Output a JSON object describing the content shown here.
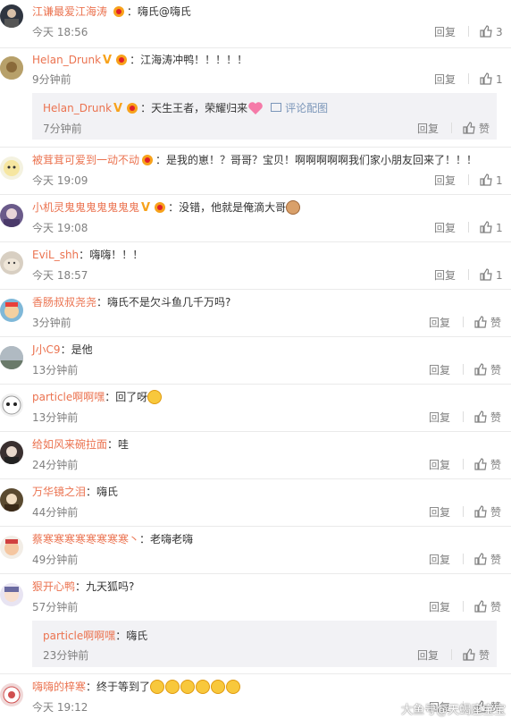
{
  "comments": [
    {
      "user": "江谦最爱江海涛",
      "content": "嗨氏@嗨氏",
      "time": "今天 18:56",
      "reply": "回复",
      "likes": "3"
    },
    {
      "user": "Helan_Drunk",
      "content": "江海涛冲鸭！！！！！",
      "time": "9分钟前",
      "reply": "回复",
      "likes": "1"
    },
    {
      "user": "Helan_Drunk",
      "content": "天生王者，荣耀归来",
      "pic_link": "评论配图",
      "time": "7分钟前",
      "reply": "回复",
      "likes": "赞"
    },
    {
      "user": "被茸茸可爱到一动不动",
      "content": "是我的崽！？哥哥？宝贝！啊啊啊啊啊我们家小朋友回来了！！！",
      "time": "今天 19:09",
      "reply": "回复",
      "likes": "1"
    },
    {
      "user": "小机灵鬼鬼鬼鬼鬼鬼鬼",
      "content": "没错，他就是俺滴大哥",
      "time": "今天 19:08",
      "reply": "回复",
      "likes": "1"
    },
    {
      "user": "EviL_shh",
      "content": "嗨嗨！！！",
      "time": "今天 18:57",
      "reply": "回复",
      "likes": "1"
    },
    {
      "user": "香肠叔叔尧尧",
      "content": "嗨氏不是欠斗鱼几千万吗?",
      "time": "3分钟前",
      "reply": "回复",
      "likes": "赞"
    },
    {
      "user": "J小C9",
      "content": "是他",
      "time": "13分钟前",
      "reply": "回复",
      "likes": "赞"
    },
    {
      "user": "particle啊啊嘿",
      "content": "回了呀",
      "time": "13分钟前",
      "reply": "回复",
      "likes": "赞"
    },
    {
      "user": "给如风来碗拉面",
      "content": "哇",
      "time": "24分钟前",
      "reply": "回复",
      "likes": "赞"
    },
    {
      "user": "万华镜之泪",
      "content": "嗨氏",
      "time": "44分钟前",
      "reply": "回复",
      "likes": "赞"
    },
    {
      "user": "蔡寒寒寒寒寒寒寒寒丶",
      "content": "老嗨老嗨",
      "time": "49分钟前",
      "reply": "回复",
      "likes": "赞"
    },
    {
      "user": "狠开心鸭",
      "content": "九天狐吗?",
      "time": "57分钟前",
      "reply": "回复",
      "likes": "赞"
    },
    {
      "user": "particle啊啊嘿",
      "content": "嗨氏",
      "time": "23分钟前",
      "reply": "回复",
      "likes": "赞"
    },
    {
      "user": "嗨嗨的梓寒",
      "content": "终于等到了",
      "time": "今天 19:12",
      "reply": "回复",
      "likes": "赞"
    }
  ],
  "watermark": "大鱼号@天蝎座宝宝",
  "colors": {
    "username": "#eb7350",
    "meta": "#808080",
    "subbg": "#f2f2f5"
  },
  "icons": [
    "verified-v-icon",
    "member-badge-icon",
    "thumb-up-icon",
    "emoji-smile-icon",
    "heart-emoji-icon",
    "image-icon"
  ]
}
